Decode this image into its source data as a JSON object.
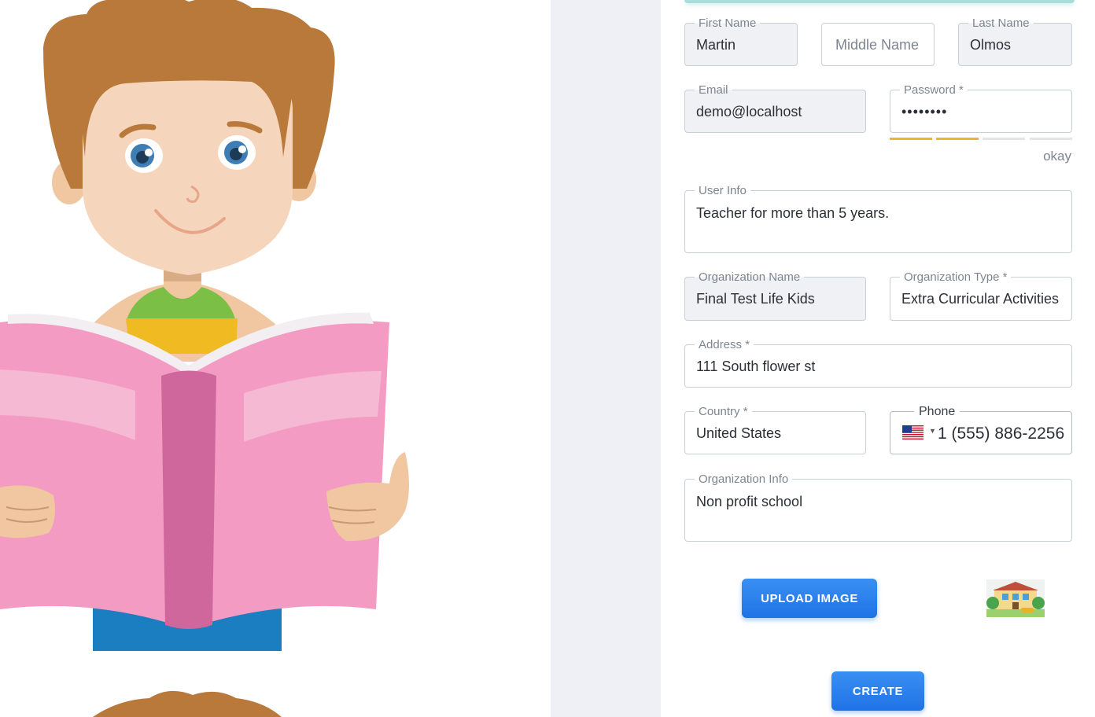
{
  "form": {
    "first_name": {
      "label": "First Name",
      "value": "Martin"
    },
    "middle_name": {
      "placeholder": "Middle Name"
    },
    "last_name": {
      "label": "Last Name",
      "value": "Olmos"
    },
    "email": {
      "label": "Email",
      "value": "demo@localhost"
    },
    "password": {
      "label": "Password *",
      "value": "••••••••",
      "strength_label": "okay",
      "strength_level": 0.5
    },
    "user_info": {
      "label": "User Info",
      "value": "Teacher for more than 5 years."
    },
    "organization_name": {
      "label": "Organization Name",
      "value": "Final Test Life Kids"
    },
    "organization_type": {
      "label": "Organization Type *",
      "value": "Extra Curricular Activities"
    },
    "address": {
      "label": "Address *",
      "value": "111 South flower st"
    },
    "country": {
      "label": "Country *",
      "value": "United States"
    },
    "phone": {
      "label": "Phone",
      "value": "1 (555) 886-2256",
      "flag_icon": "us-flag-icon"
    },
    "organization_info": {
      "label": "Organization Info",
      "value": "Non profit school"
    },
    "upload_button_label": "UPLOAD IMAGE",
    "create_button_label": "CREATE"
  },
  "colors": {
    "accent": "#1f73e6",
    "strength_on": "#f0b429",
    "gutter": "#eef0f5"
  }
}
